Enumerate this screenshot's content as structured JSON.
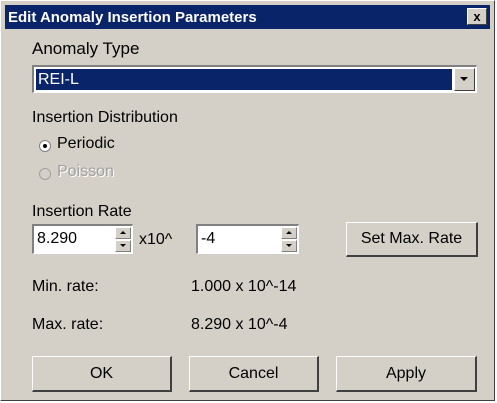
{
  "window": {
    "title": "Edit Anomaly Insertion Parameters",
    "close_glyph": "x"
  },
  "anomaly_type": {
    "label": "Anomaly Type",
    "selected": "REI-L"
  },
  "distribution": {
    "label": "Insertion Distribution",
    "options": [
      {
        "label": "Periodic",
        "checked": true,
        "enabled": true
      },
      {
        "label": "Poisson",
        "checked": false,
        "enabled": false
      }
    ]
  },
  "rate": {
    "label": "Insertion Rate",
    "mantissa": "8.290",
    "multiplier_text": "x10^",
    "exponent": "-4",
    "set_max_label": "Set Max. Rate"
  },
  "limits": {
    "min_label": "Min. rate:",
    "min_value": "1.000 x 10^-14",
    "max_label": "Max. rate:",
    "max_value": "8.290 x 10^-4"
  },
  "buttons": {
    "ok": "OK",
    "cancel": "Cancel",
    "apply": "Apply"
  }
}
